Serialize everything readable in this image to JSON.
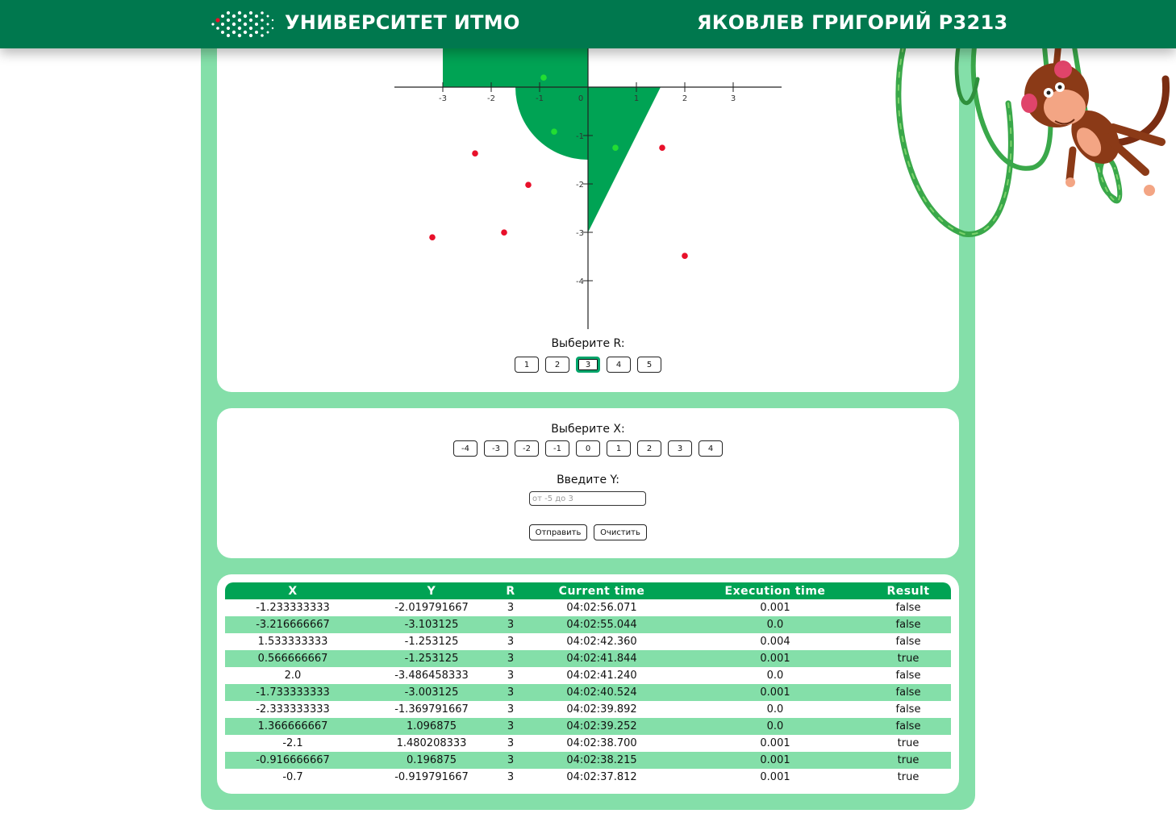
{
  "header": {
    "university": "УНИВЕРСИТЕТ ИТМО",
    "student": "ЯКОВЛЕВ ГРИГОРИЙ P3213"
  },
  "colors": {
    "header_bg": "#00784e",
    "accent_green": "#00a354",
    "container_green": "#84dfa9",
    "hit_point": "#22dd33",
    "miss_point": "#e8102a"
  },
  "graph": {
    "x_ticks": [
      "-3",
      "-2",
      "-1",
      "0",
      "1",
      "2",
      "3"
    ],
    "y_ticks": [
      "-1",
      "-2",
      "-3",
      "-4"
    ],
    "points": [
      {
        "x": -1.233333333,
        "y": -2.019791667,
        "hit": false
      },
      {
        "x": -3.216666667,
        "y": -3.103125,
        "hit": false
      },
      {
        "x": 1.533333333,
        "y": -1.253125,
        "hit": false
      },
      {
        "x": 0.566666667,
        "y": -1.253125,
        "hit": true
      },
      {
        "x": 2.0,
        "y": -3.486458333,
        "hit": false
      },
      {
        "x": -1.733333333,
        "y": -3.003125,
        "hit": false
      },
      {
        "x": -2.333333333,
        "y": -1.369791667,
        "hit": false
      },
      {
        "x": -0.916666667,
        "y": 0.196875,
        "hit": true
      },
      {
        "x": -0.7,
        "y": -0.919791667,
        "hit": true
      }
    ]
  },
  "r_select": {
    "label": "Выберите R:",
    "options": [
      "1",
      "2",
      "3",
      "4",
      "5"
    ],
    "selected": "3"
  },
  "x_select": {
    "label": "Выберите X:",
    "options": [
      "-4",
      "-3",
      "-2",
      "-1",
      "0",
      "1",
      "2",
      "3",
      "4"
    ]
  },
  "y_input": {
    "label": "Введите Y:",
    "placeholder": "от -5 до 3",
    "value": ""
  },
  "actions": {
    "submit": "Отправить",
    "clear": "Очистить"
  },
  "table": {
    "headers": [
      "X",
      "Y",
      "R",
      "Current time",
      "Execution time",
      "Result"
    ],
    "rows": [
      [
        "-1.233333333",
        "-2.019791667",
        "3",
        "04:02:56.071",
        "0.001",
        "false"
      ],
      [
        "-3.216666667",
        "-3.103125",
        "3",
        "04:02:55.044",
        "0.0",
        "false"
      ],
      [
        "1.533333333",
        "-1.253125",
        "3",
        "04:02:42.360",
        "0.004",
        "false"
      ],
      [
        "0.566666667",
        "-1.253125",
        "3",
        "04:02:41.844",
        "0.001",
        "true"
      ],
      [
        "2.0",
        "-3.486458333",
        "3",
        "04:02:41.240",
        "0.0",
        "false"
      ],
      [
        "-1.733333333",
        "-3.003125",
        "3",
        "04:02:40.524",
        "0.001",
        "false"
      ],
      [
        "-2.333333333",
        "-1.369791667",
        "3",
        "04:02:39.892",
        "0.0",
        "false"
      ],
      [
        "1.366666667",
        "1.096875",
        "3",
        "04:02:39.252",
        "0.0",
        "false"
      ],
      [
        "-2.1",
        "1.480208333",
        "3",
        "04:02:38.700",
        "0.001",
        "true"
      ],
      [
        "-0.916666667",
        "0.196875",
        "3",
        "04:02:38.215",
        "0.001",
        "true"
      ],
      [
        "-0.7",
        "-0.919791667",
        "3",
        "04:02:37.812",
        "0.001",
        "true"
      ]
    ]
  }
}
